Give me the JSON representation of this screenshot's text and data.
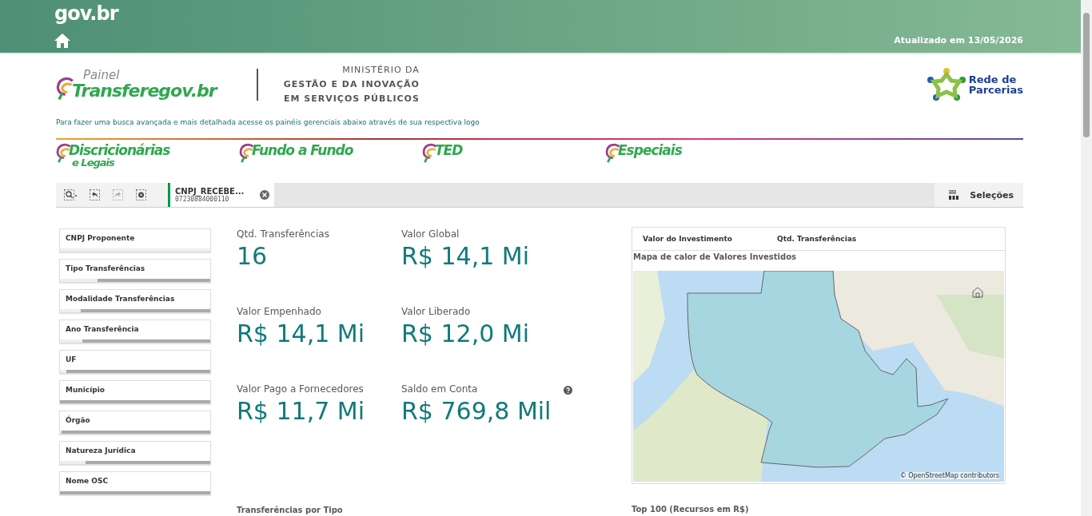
{
  "header": {
    "brand": "gov.br",
    "updated": "Atualizado em 13/05/2026"
  },
  "logo": {
    "prefix": "Painel",
    "name": "Transferegov.br"
  },
  "ministry": [
    "MINISTÉRIO DA",
    "GESTÃO E DA INOVAÇÃO",
    "EM SERVIÇOS PÚBLICOS"
  ],
  "partner_logo": [
    "Rede de",
    "Parcerias"
  ],
  "hint": "Para fazer uma busca avançada e mais detalhada acesse os painéis gerenciais abaixo através de sua respectiva logo",
  "panels": [
    {
      "title": "Discricionárias",
      "subtitle": "e Legais"
    },
    {
      "title": "Fundo a Fundo"
    },
    {
      "title": "TED"
    },
    {
      "title": "Especiais"
    }
  ],
  "selection": {
    "field": "CNPJ_RECEBE...",
    "value": "07230884000110"
  },
  "selections_button": "Seleções",
  "filters": [
    {
      "label": "CNPJ Proponente",
      "level": 1
    },
    {
      "label": "Tipo Transferências",
      "level": 0.25
    },
    {
      "label": "Modalidade Transferências",
      "level": 0.14
    },
    {
      "label": "Ano Transferência",
      "level": 0.15
    },
    {
      "label": "UF",
      "level": 0.04
    },
    {
      "label": "Município",
      "level": 0
    },
    {
      "label": "Órgão",
      "level": 0.01
    },
    {
      "label": "Natureza Jurídica",
      "level": 0.17
    },
    {
      "label": "Nome OSC",
      "level": 0
    }
  ],
  "kpis": [
    {
      "label": "Qtd. Transferências",
      "value": "16"
    },
    {
      "label": "Valor Global",
      "value": "R$ 14,1 Mi"
    },
    {
      "label": "Valor Empenhado",
      "value": "R$ 14,1 Mi"
    },
    {
      "label": "Valor Liberado",
      "value": "R$ 12,0 Mi"
    },
    {
      "label": "Valor Pago a Fornecedores",
      "value": "R$ 11,7 Mi"
    },
    {
      "label": "Saldo em Conta",
      "value": "R$ 769,8 Mil",
      "help": true
    }
  ],
  "map": {
    "tabs": [
      "Valor do Investimento",
      "Qtd. Transferências"
    ],
    "title": "Mapa de calor de Valores Investidos",
    "attribution": "© OpenStreetMap contributors"
  },
  "sections": [
    "Transferências por Tipo",
    "Top 100 (Recursos em R$)"
  ]
}
